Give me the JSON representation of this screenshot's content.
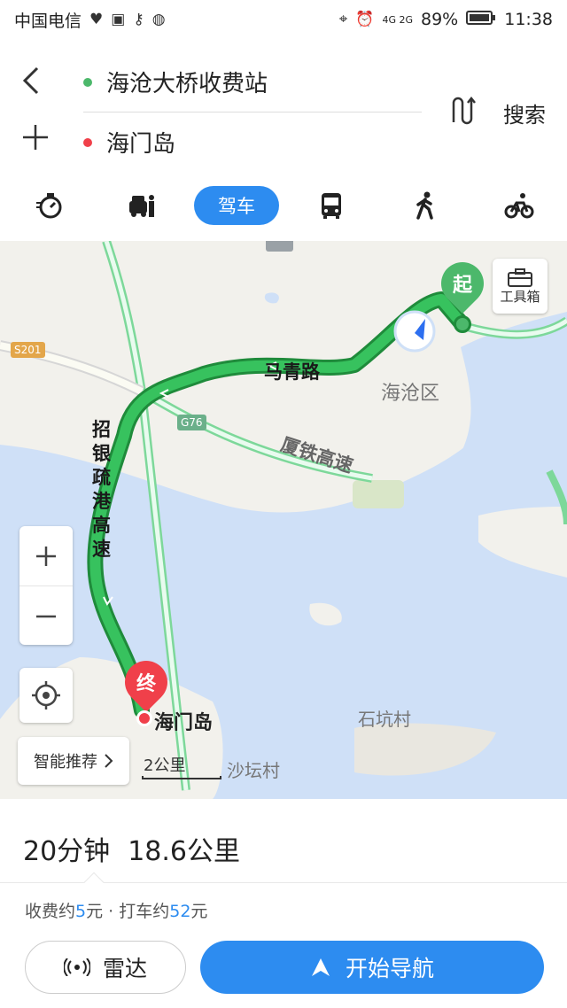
{
  "status": {
    "carrier": "中国电信",
    "signal_text": "4G 2G",
    "battery": "89%",
    "time": "11:38"
  },
  "route": {
    "start": "海沧大桥收费站",
    "end": "海门岛",
    "search_label": "搜索"
  },
  "modes": {
    "active_label": "驾车",
    "items": [
      "timer-icon",
      "taxi-icon",
      "car-icon",
      "bus-icon",
      "walk-icon",
      "bike-icon"
    ]
  },
  "map": {
    "toolbox_label": "工具箱",
    "start_pin": "起",
    "end_pin": "终",
    "end_label": "海门岛",
    "places": {
      "district": "海沧区",
      "village1": "石坑村",
      "village2": "沙坛村"
    },
    "roads": {
      "maqing": "马青路",
      "zhaoyin_1": "招",
      "zhaoyin_2": "银",
      "zhaoyin_3": "疏",
      "zhaoyin_4": "港",
      "zhaoyin_5": "高",
      "zhaoyin_6": "速",
      "xiagu": "厦铁高速",
      "s201": "S201",
      "g76": "G76"
    },
    "recommend_label": "智能推荐",
    "scale_label": "2公里",
    "colors": {
      "water": "#cfe0f7",
      "route_fill": "#37c25e",
      "route_border": "#1f8b3b",
      "accent": "#2d8cf0",
      "end_pin": "#f0404a",
      "start_pin": "#4cb86b"
    }
  },
  "panel": {
    "duration": "20分钟",
    "distance": "18.6公里",
    "toll_prefix": "收费约",
    "toll_value": "5",
    "toll_suffix": "元 · 打车约",
    "taxi_value": "52",
    "taxi_suffix": "元",
    "radar_label": "雷达",
    "start_nav_label": "开始导航"
  }
}
